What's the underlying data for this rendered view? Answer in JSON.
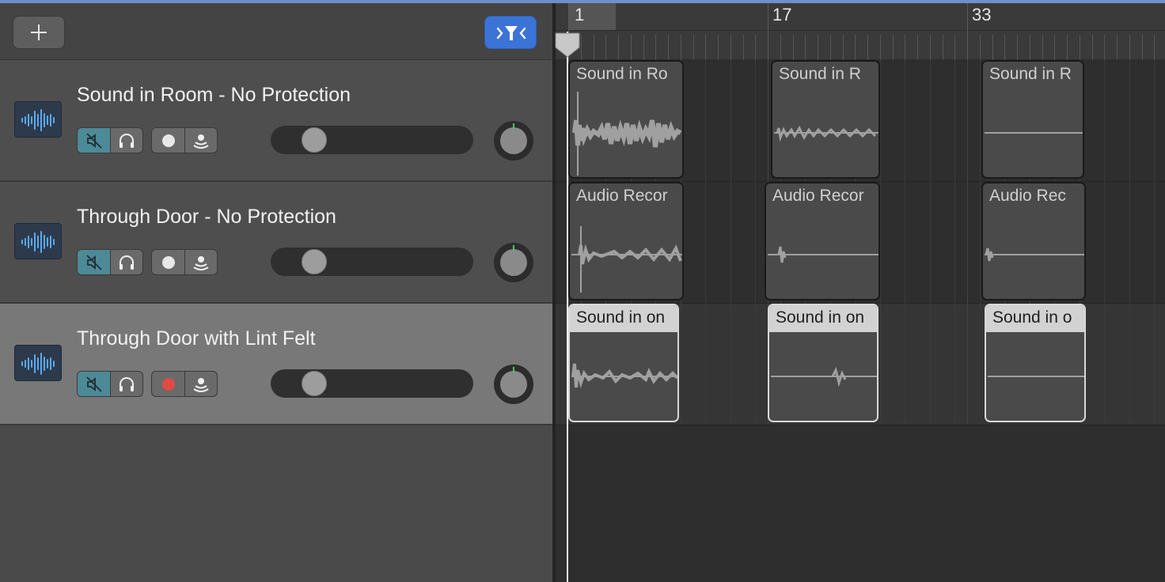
{
  "toolbar": {
    "add_icon": "plus-icon",
    "filter_icon": "catch-filter-icon",
    "filter_color": "#3b74d6"
  },
  "tracks": [
    {
      "name": "Sound in Room - No Protection",
      "muted": true,
      "record_armed": false,
      "volume": 0.2,
      "pan": 0
    },
    {
      "name": "Through Door - No Protection",
      "muted": true,
      "record_armed": false,
      "volume": 0.2,
      "pan": 0
    },
    {
      "name": "Through Door with Lint Felt",
      "muted": true,
      "record_armed": true,
      "volume": 0.2,
      "pan": 0,
      "selected": true
    }
  ],
  "ruler": {
    "markers": [
      "1",
      "17",
      "33"
    ]
  },
  "regions": [
    [
      "Sound in Ro",
      "Sound in R",
      "Sound in R"
    ],
    [
      "Audio Recor",
      "Audio Recor",
      "Audio Rec"
    ],
    [
      "Sound in on",
      "Sound in on",
      "Sound in o"
    ]
  ],
  "colors": {
    "mute_active": "#4d8a97",
    "record_armed": "#e24a43",
    "knob_tick": "#4ec36b",
    "top_accent": "#6f8fc7"
  }
}
